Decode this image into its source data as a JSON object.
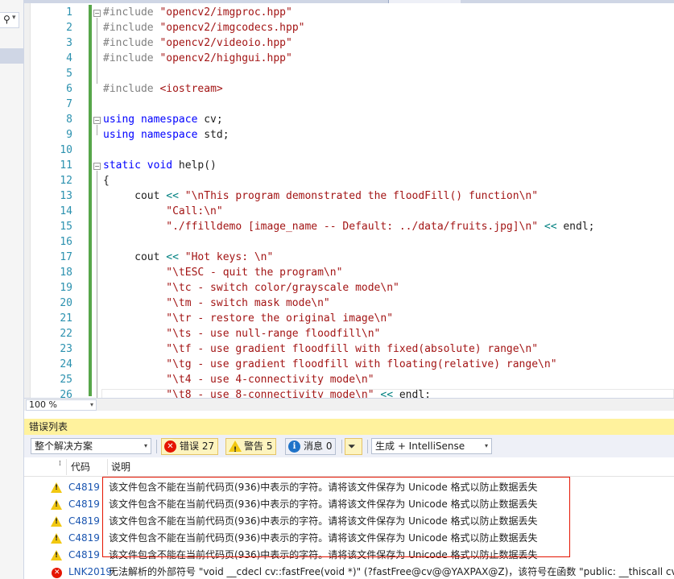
{
  "left_pane": {
    "search_icon": "search-icon"
  },
  "editor": {
    "lines": [
      {
        "n": "1",
        "segs": [
          {
            "c": "pp",
            "t": "#include "
          },
          {
            "c": "str",
            "t": "\"opencv2/imgproc.hpp\""
          }
        ]
      },
      {
        "n": "2",
        "segs": [
          {
            "c": "pp",
            "t": "#include "
          },
          {
            "c": "str",
            "t": "\"opencv2/imgcodecs.hpp\""
          }
        ]
      },
      {
        "n": "3",
        "segs": [
          {
            "c": "pp",
            "t": "#include "
          },
          {
            "c": "str",
            "t": "\"opencv2/videoio.hpp\""
          }
        ]
      },
      {
        "n": "4",
        "segs": [
          {
            "c": "pp",
            "t": "#include "
          },
          {
            "c": "str",
            "t": "\"opencv2/highgui.hpp\""
          }
        ]
      },
      {
        "n": "5",
        "segs": []
      },
      {
        "n": "6",
        "segs": [
          {
            "c": "pp",
            "t": "#include "
          },
          {
            "c": "str",
            "t": "<iostream>"
          }
        ]
      },
      {
        "n": "7",
        "segs": []
      },
      {
        "n": "8",
        "segs": [
          {
            "c": "kw",
            "t": "using namespace "
          },
          {
            "c": "id",
            "t": "cv;"
          }
        ]
      },
      {
        "n": "9",
        "segs": [
          {
            "c": "kw",
            "t": "using namespace "
          },
          {
            "c": "id",
            "t": "std;"
          }
        ]
      },
      {
        "n": "10",
        "segs": []
      },
      {
        "n": "11",
        "segs": [
          {
            "c": "kw",
            "t": "static void "
          },
          {
            "c": "id",
            "t": "help()"
          }
        ]
      },
      {
        "n": "12",
        "segs": [
          {
            "c": "id",
            "t": "{"
          }
        ]
      },
      {
        "n": "13",
        "segs": [
          {
            "c": "id",
            "t": "     cout "
          },
          {
            "c": "op",
            "t": "<< "
          },
          {
            "c": "str",
            "t": "\"\\nThis program demonstrated the floodFill() function\\n\""
          }
        ]
      },
      {
        "n": "14",
        "segs": [
          {
            "c": "str",
            "t": "          \"Call:\\n\""
          }
        ]
      },
      {
        "n": "15",
        "segs": [
          {
            "c": "str",
            "t": "          \"./ffilldemo [image_name -- Default: ../data/fruits.jpg]\\n\" "
          },
          {
            "c": "op",
            "t": "<< "
          },
          {
            "c": "id",
            "t": "endl;"
          }
        ]
      },
      {
        "n": "16",
        "segs": []
      },
      {
        "n": "17",
        "segs": [
          {
            "c": "id",
            "t": "     cout "
          },
          {
            "c": "op",
            "t": "<< "
          },
          {
            "c": "str",
            "t": "\"Hot keys: \\n\""
          }
        ]
      },
      {
        "n": "18",
        "segs": [
          {
            "c": "str",
            "t": "          \"\\tESC - quit the program\\n\""
          }
        ]
      },
      {
        "n": "19",
        "segs": [
          {
            "c": "str",
            "t": "          \"\\tc - switch color/grayscale mode\\n\""
          }
        ]
      },
      {
        "n": "20",
        "segs": [
          {
            "c": "str",
            "t": "          \"\\tm - switch mask mode\\n\""
          }
        ]
      },
      {
        "n": "21",
        "segs": [
          {
            "c": "str",
            "t": "          \"\\tr - restore the original image\\n\""
          }
        ]
      },
      {
        "n": "22",
        "segs": [
          {
            "c": "str",
            "t": "          \"\\ts - use null-range floodfill\\n\""
          }
        ]
      },
      {
        "n": "23",
        "segs": [
          {
            "c": "str",
            "t": "          \"\\tf - use gradient floodfill with fixed(absolute) range\\n\""
          }
        ]
      },
      {
        "n": "24",
        "segs": [
          {
            "c": "str",
            "t": "          \"\\tg - use gradient floodfill with floating(relative) range\\n\""
          }
        ]
      },
      {
        "n": "25",
        "segs": [
          {
            "c": "str",
            "t": "          \"\\t4 - use 4-connectivity mode\\n\""
          }
        ]
      },
      {
        "n": "26",
        "segs": [
          {
            "c": "str",
            "t": "          \"\\t8 - use 8-connectivity mode\\n\" "
          },
          {
            "c": "op",
            "t": "<< "
          },
          {
            "c": "id",
            "t": "endl;"
          }
        ]
      }
    ]
  },
  "status": {
    "zoom": "100 %"
  },
  "error_list": {
    "title": "错误列表",
    "scope": "整个解决方案",
    "errors_label": "错误 27",
    "warnings_label": "警告 5",
    "messages_label": "消息 0",
    "source": "生成 + IntelliSense",
    "columns": {
      "code": "代码",
      "description": "说明"
    },
    "rows": [
      {
        "kind": "warning",
        "code": "C4819",
        "desc": "该文件包含不能在当前代码页(936)中表示的字符。请将该文件保存为 Unicode 格式以防止数据丢失"
      },
      {
        "kind": "warning",
        "code": "C4819",
        "desc": "该文件包含不能在当前代码页(936)中表示的字符。请将该文件保存为 Unicode 格式以防止数据丢失"
      },
      {
        "kind": "warning",
        "code": "C4819",
        "desc": "该文件包含不能在当前代码页(936)中表示的字符。请将该文件保存为 Unicode 格式以防止数据丢失"
      },
      {
        "kind": "warning",
        "code": "C4819",
        "desc": "该文件包含不能在当前代码页(936)中表示的字符。请将该文件保存为 Unicode 格式以防止数据丢失"
      },
      {
        "kind": "warning",
        "code": "C4819",
        "desc": "该文件包含不能在当前代码页(936)中表示的字符。请将该文件保存为 Unicode 格式以防止数据丢失"
      },
      {
        "kind": "error",
        "code": "LNK2019",
        "desc": "无法解析的外部符号 \"void __cdecl cv::fastFree(void *)\" (?fastFree@cv@@YAXPAX@Z)，该符号在函数 \"public: __thiscall cv::Ma"
      }
    ]
  }
}
